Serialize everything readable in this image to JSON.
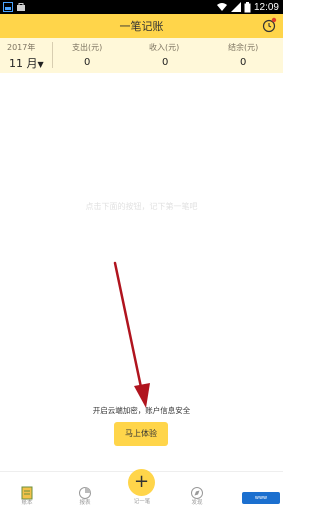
{
  "status_bar": {
    "time": "12:09"
  },
  "header": {
    "title": "一笔记账",
    "right_icon": "clock-icon"
  },
  "summary": {
    "year": "2017年",
    "month": "11 月",
    "columns": [
      {
        "label": "支出(元)",
        "value": "0"
      },
      {
        "label": "收入(元)",
        "value": "0"
      },
      {
        "label": "结余(元)",
        "value": "0"
      }
    ]
  },
  "main": {
    "empty_text": "点击下面的按钮，记下第一笔吧",
    "cloud_prompt": "开启云端加密，账户信息安全",
    "try_button": "马上体验"
  },
  "bottom_nav": {
    "items": [
      {
        "label": "账本",
        "icon": "ledger-icon"
      },
      {
        "label": "报表",
        "icon": "report-icon"
      },
      {
        "label": "记一笔",
        "icon": "plus-icon"
      },
      {
        "label": "发现",
        "icon": "discover-icon"
      }
    ]
  },
  "colors": {
    "accent": "#ffd54a",
    "summary_bg": "#fff8d9",
    "arrow": "#b0141e"
  }
}
